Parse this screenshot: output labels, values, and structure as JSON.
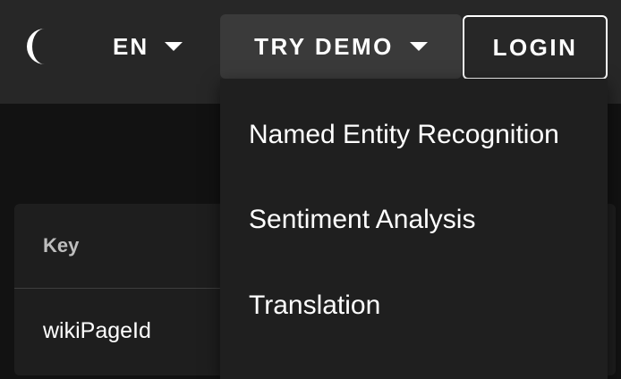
{
  "header": {
    "theme_icon": "crescent-moon-icon",
    "language": "EN",
    "demo_label": "TRY DEMO",
    "login_label": "LOGIN"
  },
  "demo_menu": {
    "items": [
      {
        "label": "Named Entity Recognition"
      },
      {
        "label": "Sentiment Analysis"
      },
      {
        "label": "Translation"
      }
    ]
  },
  "table": {
    "column_key": "Key",
    "rows": [
      {
        "key": "wikiPageId"
      }
    ]
  },
  "colors": {
    "background": "#121212",
    "appbar": "#272727",
    "menu": "#1f1f1f",
    "text": "#ffffff"
  }
}
